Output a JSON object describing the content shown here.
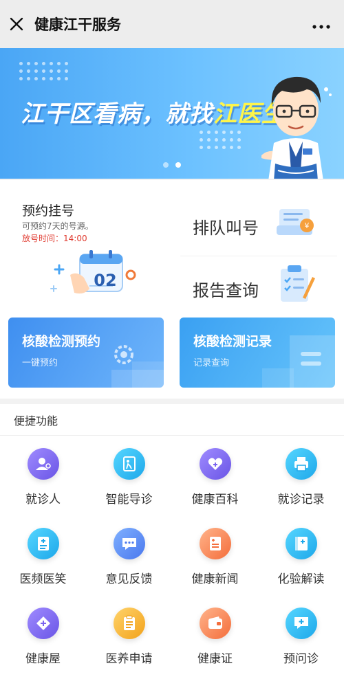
{
  "header": {
    "title": "健康江干服务",
    "close_icon": "close-icon",
    "more_icon": "more-icon"
  },
  "banner": {
    "slogan_part1": "江干区看病，就找",
    "slogan_highlight": "江医生",
    "slides_count": 2,
    "active_slide": 2
  },
  "services": {
    "registration": {
      "title": "预约挂号",
      "subtitle": "可预约7天的号源。",
      "release_time": "放号时间：14:00",
      "calendar_number": "02"
    },
    "queue": {
      "label": "排队叫号"
    },
    "report": {
      "label": "报告查询"
    },
    "covid_booking": {
      "title": "核酸检测预约",
      "subtitle": "一键预约"
    },
    "covid_record": {
      "title": "核酸检测记录",
      "subtitle": "记录查询"
    }
  },
  "quick": {
    "title": "便捷功能",
    "items": [
      {
        "label": "就诊人",
        "icon": "person-icon",
        "color": "purple"
      },
      {
        "label": "智能导诊",
        "icon": "guide-icon",
        "color": "cyan"
      },
      {
        "label": "健康百科",
        "icon": "heart-icon",
        "color": "purple"
      },
      {
        "label": "就诊记录",
        "icon": "printer-icon",
        "color": "cyan"
      },
      {
        "label": "医频医笑",
        "icon": "document-icon",
        "color": "cyan"
      },
      {
        "label": "意见反馈",
        "icon": "chat-icon",
        "color": "blue"
      },
      {
        "label": "健康新闻",
        "icon": "news-icon",
        "color": "orange"
      },
      {
        "label": "化验解读",
        "icon": "test-book-icon",
        "color": "cyan"
      },
      {
        "label": "健康屋",
        "icon": "house-icon",
        "color": "purple"
      },
      {
        "label": "医养申请",
        "icon": "clipboard-icon",
        "color": "yellow"
      },
      {
        "label": "健康证",
        "icon": "wallet-icon",
        "color": "orange"
      },
      {
        "label": "预问诊",
        "icon": "consult-icon",
        "color": "cyan"
      }
    ]
  },
  "colors": {
    "accent_blue": "#4aa6f5",
    "release_red": "#e03a2f",
    "header_bg": "#ededed"
  }
}
